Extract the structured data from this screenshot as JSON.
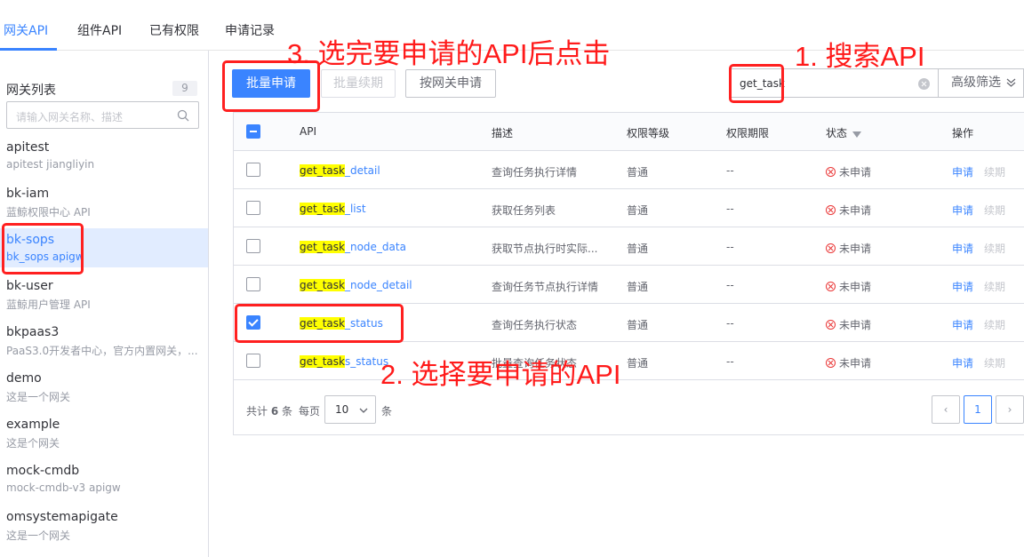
{
  "tabs": [
    "网关API",
    "组件API",
    "已有权限",
    "申请记录"
  ],
  "sidebar": {
    "title": "网关列表",
    "count": "9",
    "search_placeholder": "请输入网关名称、描述",
    "items": [
      {
        "name": "apitest",
        "desc": "apitest jiangliyin"
      },
      {
        "name": "bk-iam",
        "desc": "蓝鲸权限中心 API"
      },
      {
        "name": "bk-sops",
        "desc": "bk_sops apigw"
      },
      {
        "name": "bk-user",
        "desc": "蓝鲸用户管理 API"
      },
      {
        "name": "bkpaas3",
        "desc": "PaaS3.0开发者中心，官方内置网关，..."
      },
      {
        "name": "demo",
        "desc": "这是一个网关"
      },
      {
        "name": "example",
        "desc": "这是个网关"
      },
      {
        "name": "mock-cmdb",
        "desc": "mock-cmdb-v3 apigw"
      },
      {
        "name": "omsystemapigate",
        "desc": "这是一个网关"
      }
    ]
  },
  "toolbar": {
    "batch_apply": "批量申请",
    "batch_renew": "批量续期",
    "apply_by_gateway": "按网关申请",
    "search_value": "get_task",
    "advanced_filter": "高级筛选"
  },
  "table": {
    "headers": {
      "api": "API",
      "desc": "描述",
      "level": "权限等级",
      "expire": "权限期限",
      "status": "状态",
      "ops": "操作"
    },
    "rows": [
      {
        "api_hl": "get_task",
        "api_rest": "_detail",
        "desc": "查询任务执行详情",
        "level": "普通",
        "expire": "--",
        "status": "未申请",
        "apply": "申请",
        "renew": "续期"
      },
      {
        "api_hl": "get_task",
        "api_rest": "_list",
        "desc": "获取任务列表",
        "level": "普通",
        "expire": "--",
        "status": "未申请",
        "apply": "申请",
        "renew": "续期"
      },
      {
        "api_hl": "get_task",
        "api_rest": "_node_data",
        "desc": "获取节点执行时实际...",
        "level": "普通",
        "expire": "--",
        "status": "未申请",
        "apply": "申请",
        "renew": "续期"
      },
      {
        "api_hl": "get_task",
        "api_rest": "_node_detail",
        "desc": "查询任务节点执行详情",
        "level": "普通",
        "expire": "--",
        "status": "未申请",
        "apply": "申请",
        "renew": "续期"
      },
      {
        "api_hl": "get_task",
        "api_rest": "_status",
        "desc": "查询任务执行状态",
        "level": "普通",
        "expire": "--",
        "status": "未申请",
        "apply": "申请",
        "renew": "续期"
      },
      {
        "api_hl": "get_task",
        "api_rest": "s_status",
        "desc": "批量查询任务状态",
        "level": "普通",
        "expire": "--",
        "status": "未申请",
        "apply": "申请",
        "renew": "续期"
      }
    ]
  },
  "pagination": {
    "total_prefix": "共计",
    "total": "6",
    "total_suffix": "条",
    "per_page_label": "每页",
    "per_page": "10",
    "per_page_suffix": "条",
    "page": "1"
  },
  "annotations": {
    "step1": "1. 搜索API",
    "step2": "2. 选择要申请的API",
    "step3": "3. 选完要申请的API后点击"
  }
}
